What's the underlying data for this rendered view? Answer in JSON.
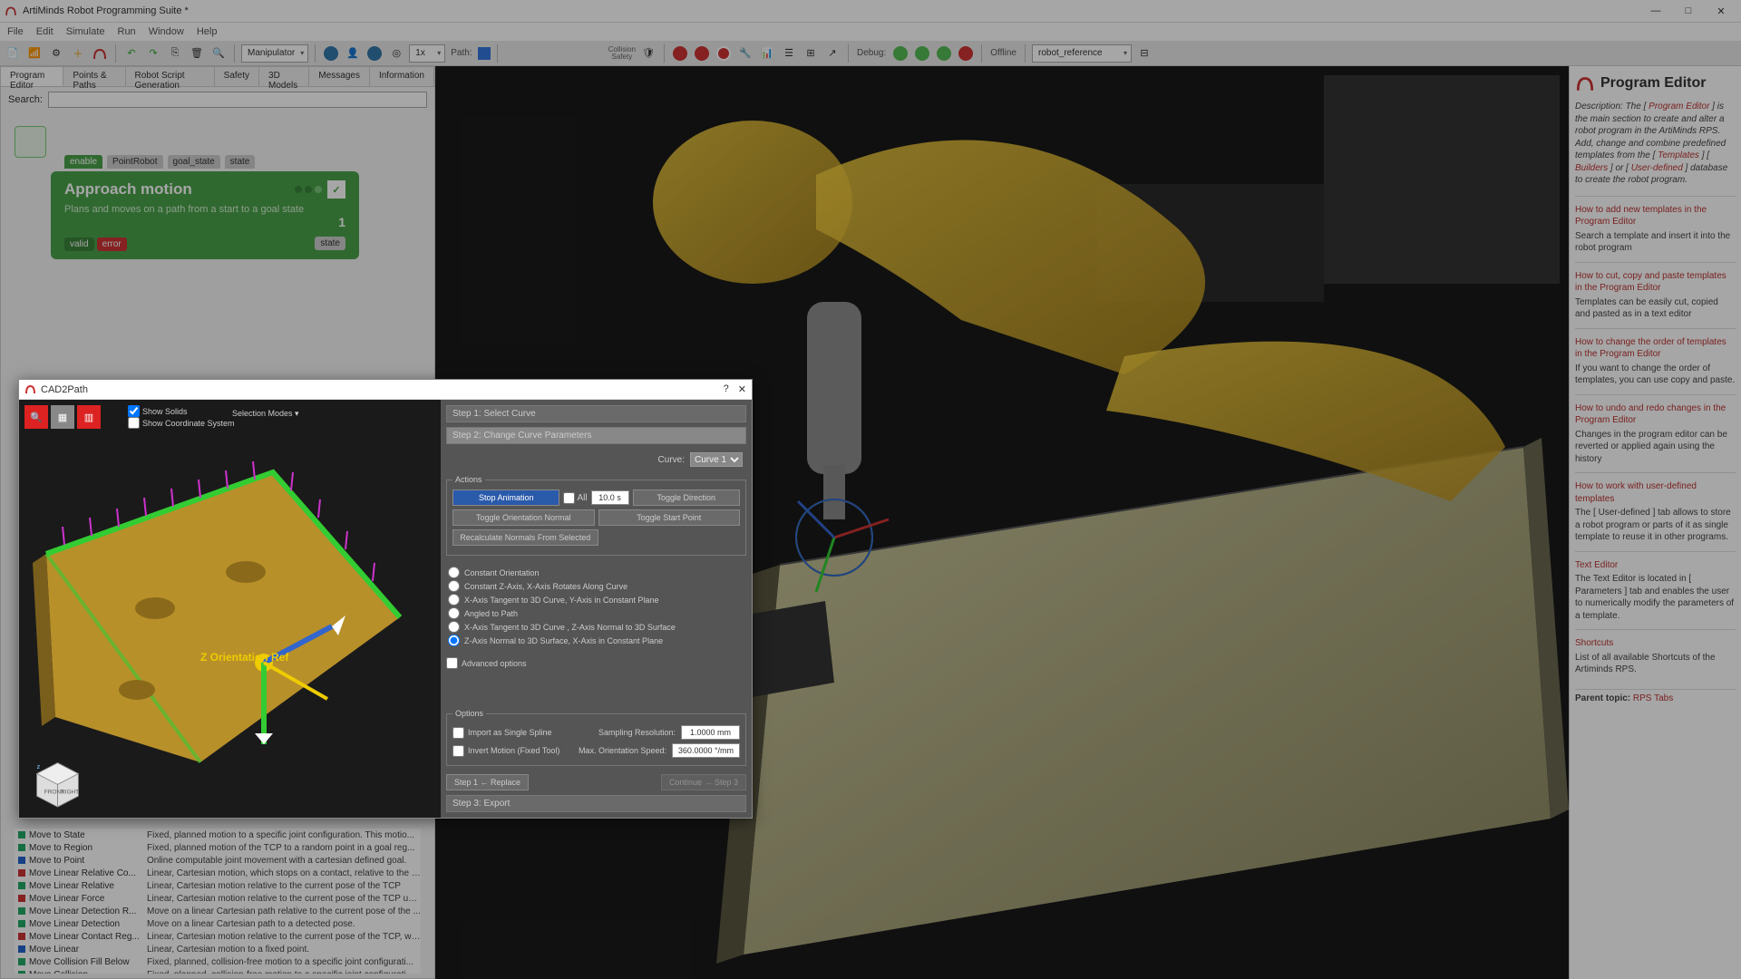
{
  "window": {
    "title": "ArtiMinds Robot Programming Suite *",
    "min": "—",
    "max": "□",
    "close": "✕"
  },
  "menu": [
    "File",
    "Edit",
    "Simulate",
    "Run",
    "Window",
    "Help"
  ],
  "toolbar": {
    "manipulator": "Manipulator",
    "zoom": "1x",
    "path_label": "Path:",
    "collision_label": "Collision\nSafety",
    "debug_label": "Debug:",
    "offline": "Offline",
    "robot_ref": "robot_reference"
  },
  "left": {
    "tabs": [
      "Program Editor",
      "Points & Paths",
      "Robot Script Generation",
      "Safety",
      "3D Models",
      "Messages",
      "Information"
    ],
    "search_label": "Search:",
    "block": {
      "tabs": [
        "enable",
        "PointRobot",
        "goal_state",
        "state"
      ],
      "title": "Approach motion",
      "desc": "Plans and moves on a path from a start to a goal state",
      "valid": "valid",
      "error": "error",
      "idx": "1",
      "state": "state"
    },
    "templates": [
      {
        "c": "#2a6",
        "n": "Move to State",
        "d": "Fixed, planned motion to a specific joint configuration. This motio..."
      },
      {
        "c": "#2a6",
        "n": "Move to Region",
        "d": "Fixed, planned motion of the TCP to a random point in a goal reg..."
      },
      {
        "c": "#26c",
        "n": "Move to Point",
        "d": "Online computable joint movement with a cartesian defined goal."
      },
      {
        "c": "#c33",
        "n": "Move Linear Relative Co...",
        "d": "Linear, Cartesian motion, which stops on a contact, relative to the c..."
      },
      {
        "c": "#2a6",
        "n": "Move Linear Relative",
        "d": "Linear, Cartesian motion relative to the current pose of the TCP"
      },
      {
        "c": "#c33",
        "n": "Move Linear Force",
        "d": "Linear, Cartesian motion relative to the current pose of the TCP usi..."
      },
      {
        "c": "#2a6",
        "n": "Move Linear Detection R...",
        "d": "Move on a linear Cartesian path relative to the current pose of the ..."
      },
      {
        "c": "#2a6",
        "n": "Move Linear Detection",
        "d": "Move on a linear Cartesian path to a detected pose."
      },
      {
        "c": "#c33",
        "n": "Move Linear Contact Reg...",
        "d": "Linear, Cartesian motion relative to the current pose of the TCP, wh..."
      },
      {
        "c": "#26c",
        "n": "Move Linear",
        "d": "Linear, Cartesian motion to a fixed point."
      },
      {
        "c": "#2a6",
        "n": "Move Collision Fill Below",
        "d": "Fixed, planned, collision-free motion to a specific joint configurati..."
      },
      {
        "c": "#2a6",
        "n": "Move Collision",
        "d": "Fixed, planned, collision-free motion to a specific joint configurati..."
      }
    ]
  },
  "help": {
    "title": "Program Editor",
    "desc_pre": "Description: The [ ",
    "desc_link1": "Program Editor",
    "desc_mid1": " ] is the main section to create and alter a robot program in the ArtiMinds RPS. Add, change and combine predefined templates from the [ ",
    "desc_link2": "Templates",
    "desc_mid2": " ] [ ",
    "desc_link3": "Builders",
    "desc_mid3": " ] or [ ",
    "desc_link4": "User-defined",
    "desc_end": " ] database to create the robot program.",
    "cards": [
      {
        "t": "How to add new templates in the Program Editor",
        "d": "Search a template and insert it into the robot program"
      },
      {
        "t": "How to cut, copy and paste templates in the Program Editor",
        "d": "Templates can be easily cut, copied and pasted as in a text editor"
      },
      {
        "t": "How to change the order of templates in the Program Editor",
        "d": "If you want to change the order of templates, you can use copy and paste."
      },
      {
        "t": "How to undo and redo changes in the Program Editor",
        "d": "Changes in the program editor can be reverted or applied again using the history"
      },
      {
        "t": "How to work with user-defined templates",
        "d": "The [ User-defined ] tab allows to store a robot program or parts of it as single template to reuse it in other programs."
      },
      {
        "t": "Text Editor",
        "d": "The Text Editor is located in [ Parameters ] tab and enables the user to numerically modify the parameters of a template."
      },
      {
        "t": "Shortcuts",
        "d": "List of all available Shortcuts of the Artiminds RPS."
      }
    ],
    "parent_label": "Parent topic:",
    "parent_link": "RPS Tabs"
  },
  "modal": {
    "title": "CAD2Path",
    "show_solids": "Show Solids",
    "show_cs": "Show Coordinate System",
    "sel_modes": "Selection Modes ▾",
    "z_label": "Z Orientation Ref",
    "step1": "Step 1: Select Curve",
    "step2": "Step 2: Change Curve Parameters",
    "step3": "Step 3: Export",
    "curve_label": "Curve:",
    "curve_val": "Curve 1",
    "actions_label": "Actions",
    "stop_anim": "Stop Animation",
    "all": "All",
    "duration": "10.0 s",
    "toggle_dir": "Toggle Direction",
    "toggle_orient": "Toggle Orientation Normal",
    "toggle_start": "Toggle Start Point",
    "recalc": "Recalculate Normals From Selected",
    "radios": [
      "Constant Orientation",
      "Constant Z-Axis, X-Axis Rotates Along Curve",
      "X-Axis Tangent to 3D Curve, Y-Axis in Constant Plane",
      "Angled to Path",
      "X-Axis Tangent to 3D Curve , Z-Axis Normal to 3D Surface",
      "Z-Axis Normal to 3D Surface, X-Axis  in Constant Plane"
    ],
    "adv": "Advanced options",
    "options_label": "Options",
    "import_spline": "Import as Single Spline",
    "samp_label": "Sampling Resolution:",
    "samp_val": "1.0000 mm",
    "invert": "Invert Motion (Fixed Tool)",
    "orient_label": "Max. Orientation Speed:",
    "orient_val": "360.0000 °/mm",
    "back": "Step 1 ← Replace",
    "next": "Continue → Step 3"
  }
}
